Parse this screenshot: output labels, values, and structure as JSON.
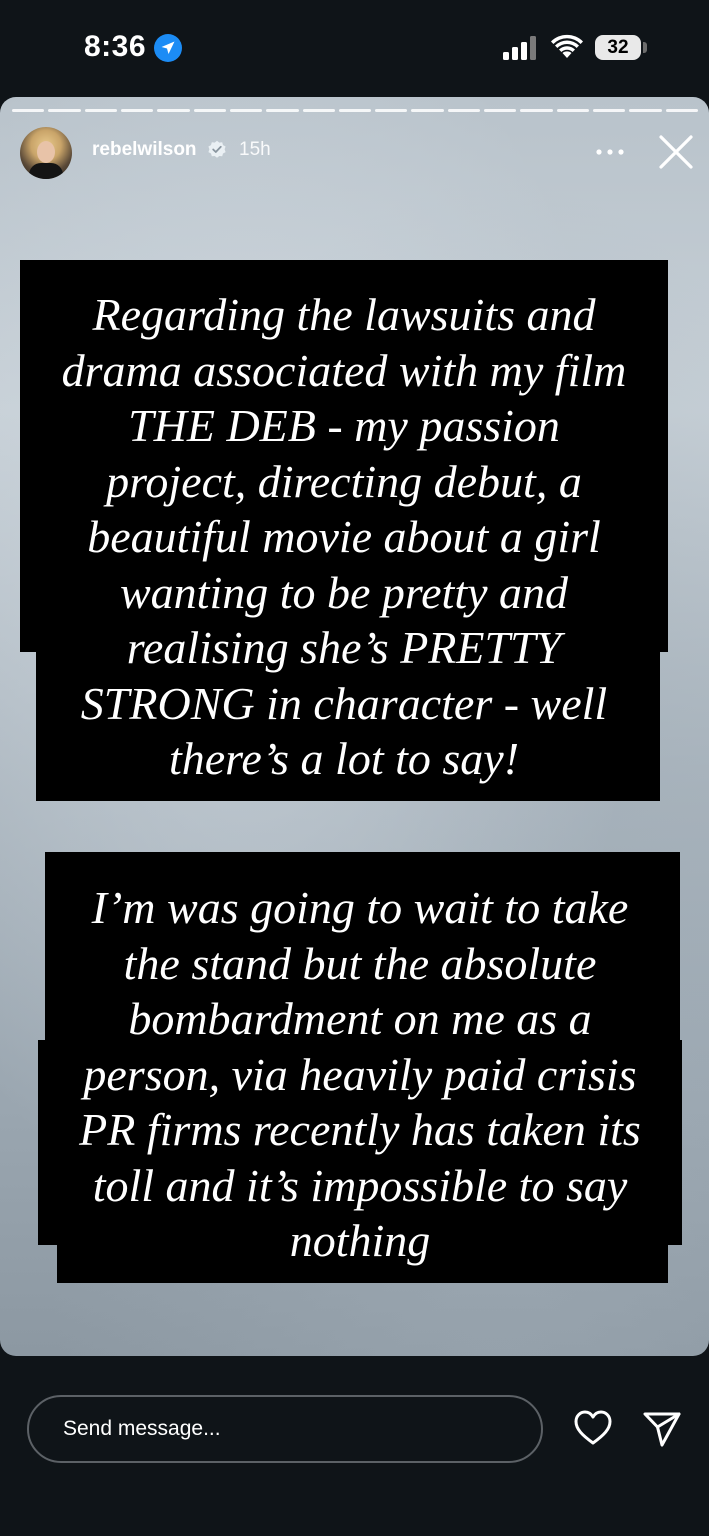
{
  "status_bar": {
    "time": "8:36",
    "battery": "32",
    "icons": [
      "location-arrow-icon",
      "cellular-signal-icon",
      "wifi-icon",
      "battery-icon"
    ]
  },
  "story": {
    "segment_count": 19,
    "username": "rebelwilson",
    "verified": true,
    "timestamp": "15h",
    "text_block_1_lines": [
      "Regarding the lawsuits and",
      "drama associated with my film",
      "THE DEB - my passion",
      "project, directing debut, a",
      "beautiful movie about a girl",
      "wanting to be pretty and",
      "realising she’s PRETTY",
      "STRONG in character - well",
      "there’s a lot to say!"
    ],
    "text_block_2_lines": [
      "I’m was going to wait to take",
      "the stand but the absolute",
      "bombardment on me as a",
      "person, via heavily paid crisis",
      "PR firms recently has taken its",
      "toll and it’s impossible to say",
      "nothing"
    ],
    "colors": {
      "text_block_bg": "#000000",
      "text": "#ffffff"
    }
  },
  "bottom_bar": {
    "message_placeholder": "Send message...",
    "icons": [
      "heart-icon",
      "send-icon"
    ]
  }
}
